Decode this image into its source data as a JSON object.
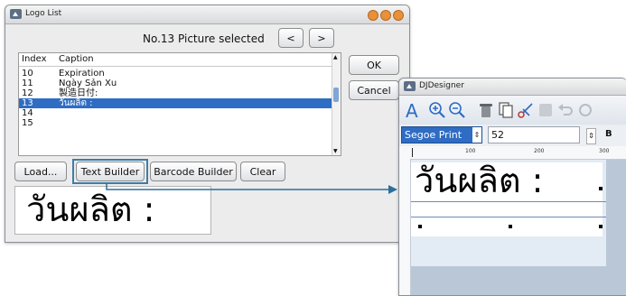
{
  "logo_window": {
    "title": "Logo List",
    "status": "No.13 Picture selected",
    "prev_label": "<",
    "next_label": ">",
    "ok_label": "OK",
    "cancel_label": "Cancel",
    "columns": [
      "Index",
      "Caption"
    ],
    "rows": [
      {
        "index": "10",
        "caption": "Expiration",
        "selected": false
      },
      {
        "index": "11",
        "caption": "Ngày Sản Xu",
        "selected": false
      },
      {
        "index": "12",
        "caption": "製造日付:",
        "selected": false
      },
      {
        "index": "13",
        "caption": "วันผลิต :",
        "selected": true
      },
      {
        "index": "14",
        "caption": "",
        "selected": false
      },
      {
        "index": "15",
        "caption": "",
        "selected": false
      }
    ],
    "buttons": {
      "load": "Load...",
      "text_builder": "Text Builder",
      "barcode_builder": "Barcode Builder",
      "clear": "Clear"
    },
    "preview_text": "วันผลิต :"
  },
  "designer_window": {
    "title": "DJDesigner",
    "font_name": "Segoe Print",
    "font_size": "52",
    "bold_label": "B",
    "ruler_labels": [
      "100",
      "200",
      "300"
    ],
    "canvas_text": "วันผลิต :"
  },
  "icons": [
    "app-logo-icon",
    "font-a-icon",
    "zoom-in-icon",
    "zoom-out-icon",
    "trash-icon",
    "copy-icon",
    "cut-icon",
    "undo-icon",
    "spin-icon"
  ],
  "colors": {
    "selection": "#2f6cc3",
    "highlight_border": "#3d7ea6",
    "arrow": "#2d6f9c",
    "traffic_orange": "#e8913a",
    "canvas_bg": "#e3ebf4",
    "designer_bg": "#b9c7d6"
  }
}
